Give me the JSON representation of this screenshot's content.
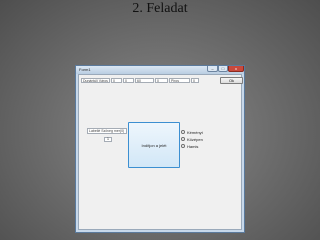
{
  "slide": {
    "title": "2. Feladat"
  },
  "window": {
    "title": "Form1",
    "controls": {
      "minimize": "–",
      "maximize": "□",
      "close": "x"
    }
  },
  "toolbar": {
    "fields": [
      {
        "name": "field-1",
        "value": "Dunántúli Város"
      },
      {
        "name": "field-2",
        "value": "0"
      },
      {
        "name": "field-3",
        "value": "0"
      },
      {
        "name": "field-4",
        "value": "60"
      },
      {
        "name": "field-5",
        "value": "0"
      },
      {
        "name": "field-6",
        "value": "Piros"
      },
      {
        "name": "field-7",
        "value": "0"
      }
    ],
    "ok_label": "Ok"
  },
  "main": {
    "label_text": "Labellé Szöveg mer(0)",
    "number_value": "1",
    "big_button_label": "Indítjon a jelét",
    "radios": [
      {
        "label": "Kéményt"
      },
      {
        "label": "Középen"
      },
      {
        "label": "Hamis"
      }
    ]
  },
  "colors": {
    "accent": "#3c8fd1",
    "close_button": "#c9493c",
    "window_frame": "#c7d8ea"
  }
}
